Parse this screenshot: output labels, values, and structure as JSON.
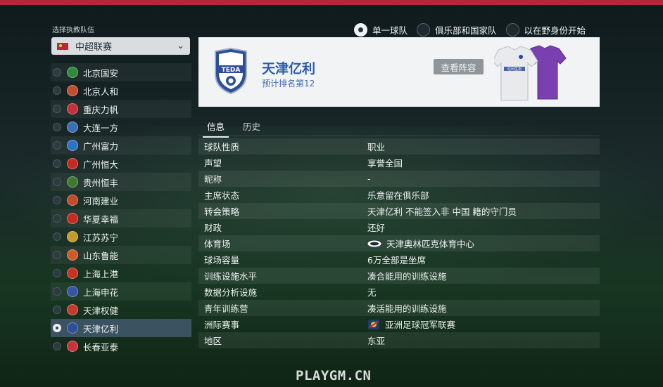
{
  "selector": {
    "label": "选择执教队伍",
    "league": "中超联赛"
  },
  "scope_options": [
    {
      "label": "单一球队",
      "selected": true
    },
    {
      "label": "俱乐部和国家队",
      "selected": false
    },
    {
      "label": "以在野身份开始",
      "selected": false
    }
  ],
  "teams": [
    {
      "name": "北京国安",
      "color": "#2f8a3a",
      "selected": false
    },
    {
      "name": "北京人和",
      "color": "#c24d2a",
      "selected": false
    },
    {
      "name": "重庆力帆",
      "color": "#c23038",
      "selected": false
    },
    {
      "name": "大连一方",
      "color": "#3c6fb6",
      "selected": false
    },
    {
      "name": "广州富力",
      "color": "#2a75c8",
      "selected": false
    },
    {
      "name": "广州恒大",
      "color": "#c8281f",
      "selected": false
    },
    {
      "name": "贵州恒丰",
      "color": "#3b7a2c",
      "selected": false
    },
    {
      "name": "河南建业",
      "color": "#c44b28",
      "selected": false
    },
    {
      "name": "华夏幸福",
      "color": "#c82a22",
      "selected": false
    },
    {
      "name": "江苏苏宁",
      "color": "#c79a2a",
      "selected": false
    },
    {
      "name": "山东鲁能",
      "color": "#d1592a",
      "selected": false
    },
    {
      "name": "上海上港",
      "color": "#c8321f",
      "selected": false
    },
    {
      "name": "上海申花",
      "color": "#3356a8",
      "selected": false
    },
    {
      "name": "天津权健",
      "color": "#c63a2a",
      "selected": false
    },
    {
      "name": "天津亿利",
      "color": "#2d4f9a",
      "selected": true
    },
    {
      "name": "长春亚泰",
      "color": "#c8323a",
      "selected": false
    }
  ],
  "club": {
    "name": "天津亿利",
    "rank": "预计排名第12",
    "view_squad": "查看阵容",
    "crest_text": "TEDA",
    "kit_sponsor": "亿利生态",
    "colors": {
      "home": "#e8eaec",
      "away": "#7a3fb0",
      "trim": "#2b4aa0"
    }
  },
  "tabs": [
    {
      "label": "信息",
      "active": true
    },
    {
      "label": "历史",
      "active": false
    }
  ],
  "info_rows": [
    {
      "key": "球队性质",
      "value": "职业",
      "icon": null
    },
    {
      "key": "声望",
      "value": "享誉全国",
      "icon": null
    },
    {
      "key": "昵称",
      "value": "-",
      "icon": null
    },
    {
      "key": "主席状态",
      "value": "乐意留在俱乐部",
      "icon": null
    },
    {
      "key": "转会策略",
      "value": "天津亿利 不能签入非 中国 籍的守门员",
      "icon": null
    },
    {
      "key": "财政",
      "value": "还好",
      "icon": null
    },
    {
      "key": "体育场",
      "value": "天津奥林匹克体育中心",
      "icon": "stadium-icon"
    },
    {
      "key": "球场容量",
      "value": "6万全部是坐席",
      "icon": null
    },
    {
      "key": "训练设施水平",
      "value": "凑合能用的训练设施",
      "icon": null
    },
    {
      "key": "数据分析设施",
      "value": "无",
      "icon": null
    },
    {
      "key": "青年训练营",
      "value": "凑活能用的训练设施",
      "icon": null
    },
    {
      "key": "洲际赛事",
      "value": "亚洲足球冠军联赛",
      "icon": "afc-icon"
    },
    {
      "key": "地区",
      "value": "东亚",
      "icon": null
    }
  ],
  "watermark": "PLAYGM.CN"
}
